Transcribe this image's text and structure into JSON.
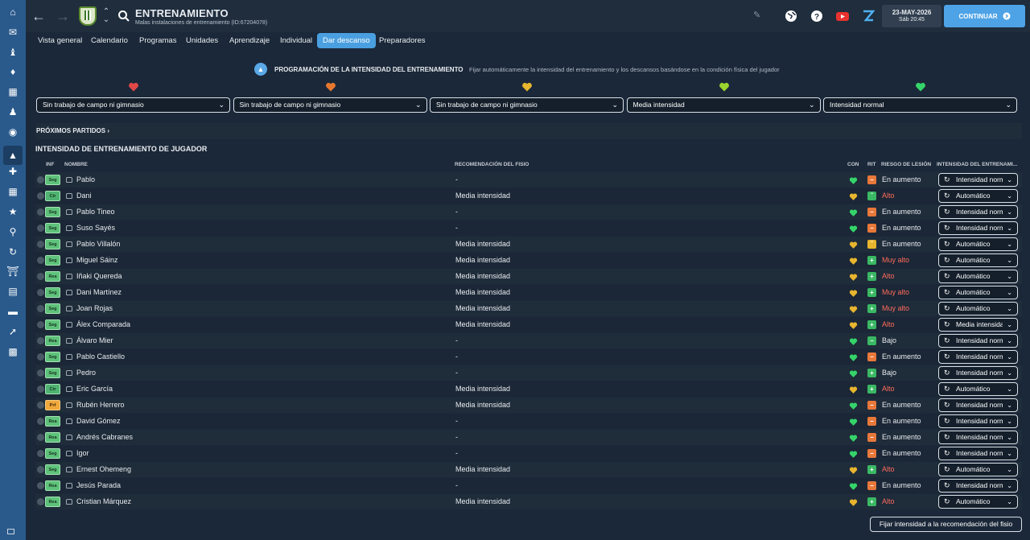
{
  "header": {
    "title": "ENTRENAMIENTO",
    "subtitle": "Malas instalaciones de entrenamiento (ID:67204078)",
    "date": "23-MAY-2026",
    "time": "Sáb 20:45",
    "continue_label": "CONTINUAR"
  },
  "tabs": [
    "Vista general",
    "Calendario",
    "Programas",
    "Unidades",
    "Aprendizaje",
    "Individual",
    "Dar descanso",
    "Preparadores"
  ],
  "active_tab": "Dar descanso",
  "programming": {
    "heading": "PROGRAMACIÓN DE LA INTENSIDAD DEL ENTRENAMIENTO",
    "description": "Fijar automáticamente la intensidad del entrenamiento y los descansos basándose en la condición física del jugador"
  },
  "condition_levels": [
    {
      "icon": "heart-red-icon",
      "color": "#e04848",
      "value": "Sin trabajo de campo ni gimnasio"
    },
    {
      "icon": "heart-orange-icon",
      "color": "#e8782e",
      "value": "Sin trabajo de campo ni gimnasio"
    },
    {
      "icon": "heart-yellow-icon",
      "color": "#e8b52e",
      "value": "Sin trabajo de campo ni gimnasio"
    },
    {
      "icon": "heart-lime-icon",
      "color": "#9ad42e",
      "value": "Media intensidad"
    },
    {
      "icon": "heart-green-icon",
      "color": "#35d46a",
      "value": "Intensidad normal"
    }
  ],
  "upcoming": "PRÓXIMOS PARTIDOS",
  "section_title": "INTENSIDAD DE ENTRENAMIENTO DE JUGADOR",
  "columns": {
    "inf": "INF",
    "name": "NOMBRE",
    "physio": "RECOMENDACIÓN DEL FISIO",
    "con": "CON",
    "rit": "RIT",
    "risk": "RIESGO DE LESIÓN",
    "intensity": "INTENSIDAD DEL ENTRENAMI..."
  },
  "players": [
    {
      "badge": "Seg",
      "name": "Pablo",
      "physio": "-",
      "con": "green",
      "rit": "orange",
      "risk": "En aumento",
      "risk_red": false,
      "intensity": "Intensidad normal"
    },
    {
      "badge": "Ctr",
      "name": "Dani",
      "physio": "Media intensidad",
      "con": "yellow",
      "rit": "green-up",
      "risk": "Alto",
      "risk_red": true,
      "intensity": "Automático"
    },
    {
      "badge": "Seg",
      "name": "Pablo Tineo",
      "physio": "-",
      "con": "green",
      "rit": "orange",
      "risk": "En aumento",
      "risk_red": false,
      "intensity": "Intensidad normal"
    },
    {
      "badge": "Seg",
      "name": "Suso Sayés",
      "physio": "-",
      "con": "green",
      "rit": "orange",
      "risk": "En aumento",
      "risk_red": false,
      "intensity": "Intensidad normal"
    },
    {
      "badge": "Seg",
      "name": "Pablo Villalón",
      "physio": "Media intensidad",
      "con": "yellow",
      "rit": "yellow-up",
      "risk": "En aumento",
      "risk_red": false,
      "intensity": "Automático"
    },
    {
      "badge": "Seg",
      "name": "Miguel Sáinz",
      "physio": "Media intensidad",
      "con": "yellow",
      "rit": "green",
      "risk": "Muy alto",
      "risk_red": true,
      "intensity": "Automático"
    },
    {
      "badge": "Rea",
      "name": "Iñaki Quereda",
      "physio": "Media intensidad",
      "con": "yellow",
      "rit": "green",
      "risk": "Alto",
      "risk_red": true,
      "intensity": "Automático"
    },
    {
      "badge": "Seg",
      "name": "Dani Martínez",
      "physio": "Media intensidad",
      "con": "yellow",
      "rit": "green",
      "risk": "Muy alto",
      "risk_red": true,
      "intensity": "Automático"
    },
    {
      "badge": "Seg",
      "name": "Joan Rojas",
      "physio": "Media intensidad",
      "con": "yellow",
      "rit": "green",
      "risk": "Muy alto",
      "risk_red": true,
      "intensity": "Automático"
    },
    {
      "badge": "Seg",
      "name": "Álex Comparada",
      "physio": "Media intensidad",
      "con": "yellow",
      "rit": "green",
      "risk": "Alto",
      "risk_red": true,
      "intensity": "Media intensidad"
    },
    {
      "badge": "Rea",
      "name": "Álvaro Mier",
      "physio": "-",
      "con": "green",
      "rit": "green-flat",
      "risk": "Bajo",
      "risk_red": false,
      "intensity": "Intensidad normal"
    },
    {
      "badge": "Seg",
      "name": "Pablo Castiello",
      "physio": "-",
      "con": "green",
      "rit": "orange",
      "risk": "En aumento",
      "risk_red": false,
      "intensity": "Intensidad normal"
    },
    {
      "badge": "Seg",
      "name": "Pedro",
      "physio": "-",
      "con": "green",
      "rit": "green",
      "risk": "Bajo",
      "risk_red": false,
      "intensity": "Intensidad normal"
    },
    {
      "badge": "Ctr",
      "name": "Eric García",
      "physio": "Media intensidad",
      "con": "yellow",
      "rit": "green",
      "risk": "Alto",
      "risk_red": true,
      "intensity": "Automático"
    },
    {
      "badge": "Prf",
      "name": "Rubén Herrero",
      "physio": "Media intensidad",
      "con": "green",
      "rit": "orange",
      "risk": "En aumento",
      "risk_red": false,
      "intensity": "Intensidad normal"
    },
    {
      "badge": "Rea",
      "name": "David Gómez",
      "physio": "-",
      "con": "green",
      "rit": "orange",
      "risk": "En aumento",
      "risk_red": false,
      "intensity": "Intensidad normal"
    },
    {
      "badge": "Rea",
      "name": "Andrés Cabranes",
      "physio": "-",
      "con": "green",
      "rit": "orange",
      "risk": "En aumento",
      "risk_red": false,
      "intensity": "Intensidad normal"
    },
    {
      "badge": "Seg",
      "name": "Igor",
      "physio": "-",
      "con": "green",
      "rit": "orange",
      "risk": "En aumento",
      "risk_red": false,
      "intensity": "Intensidad normal"
    },
    {
      "badge": "Seg",
      "name": "Ernest Ohemeng",
      "physio": "Media intensidad",
      "con": "yellow",
      "rit": "green",
      "risk": "Alto",
      "risk_red": true,
      "intensity": "Automático"
    },
    {
      "badge": "Rea",
      "name": "Jesús Parada",
      "physio": "-",
      "con": "green",
      "rit": "orange",
      "risk": "En aumento",
      "risk_red": false,
      "intensity": "Intensidad normal"
    },
    {
      "badge": "Rea",
      "name": "Cristian Márquez",
      "physio": "Media intensidad",
      "con": "yellow",
      "rit": "green",
      "risk": "Alto",
      "risk_red": true,
      "intensity": "Automático"
    }
  ],
  "fix_button": "Fijar intensidad a la recomendación del fisio",
  "colors": {
    "accent": "#4a9fe0",
    "risk_red": "#ff6b5b",
    "con_green": "#35d46a",
    "con_yellow": "#e8b52e",
    "rit_orange": "#e8783a",
    "rit_green": "#3ab863"
  },
  "rail_icons": [
    "home-icon",
    "inbox-icon",
    "squad-icon",
    "dynamics-icon",
    "tactics-icon",
    "staff-icon",
    "scouting-icon",
    "training-icon",
    "medical-icon",
    "schedule-icon",
    "competitions-icon",
    "search-icon",
    "transfers-icon",
    "club-info-icon",
    "finances-icon",
    "development-icon",
    "data-hub-icon",
    "analytics-icon",
    "manager-icon"
  ]
}
